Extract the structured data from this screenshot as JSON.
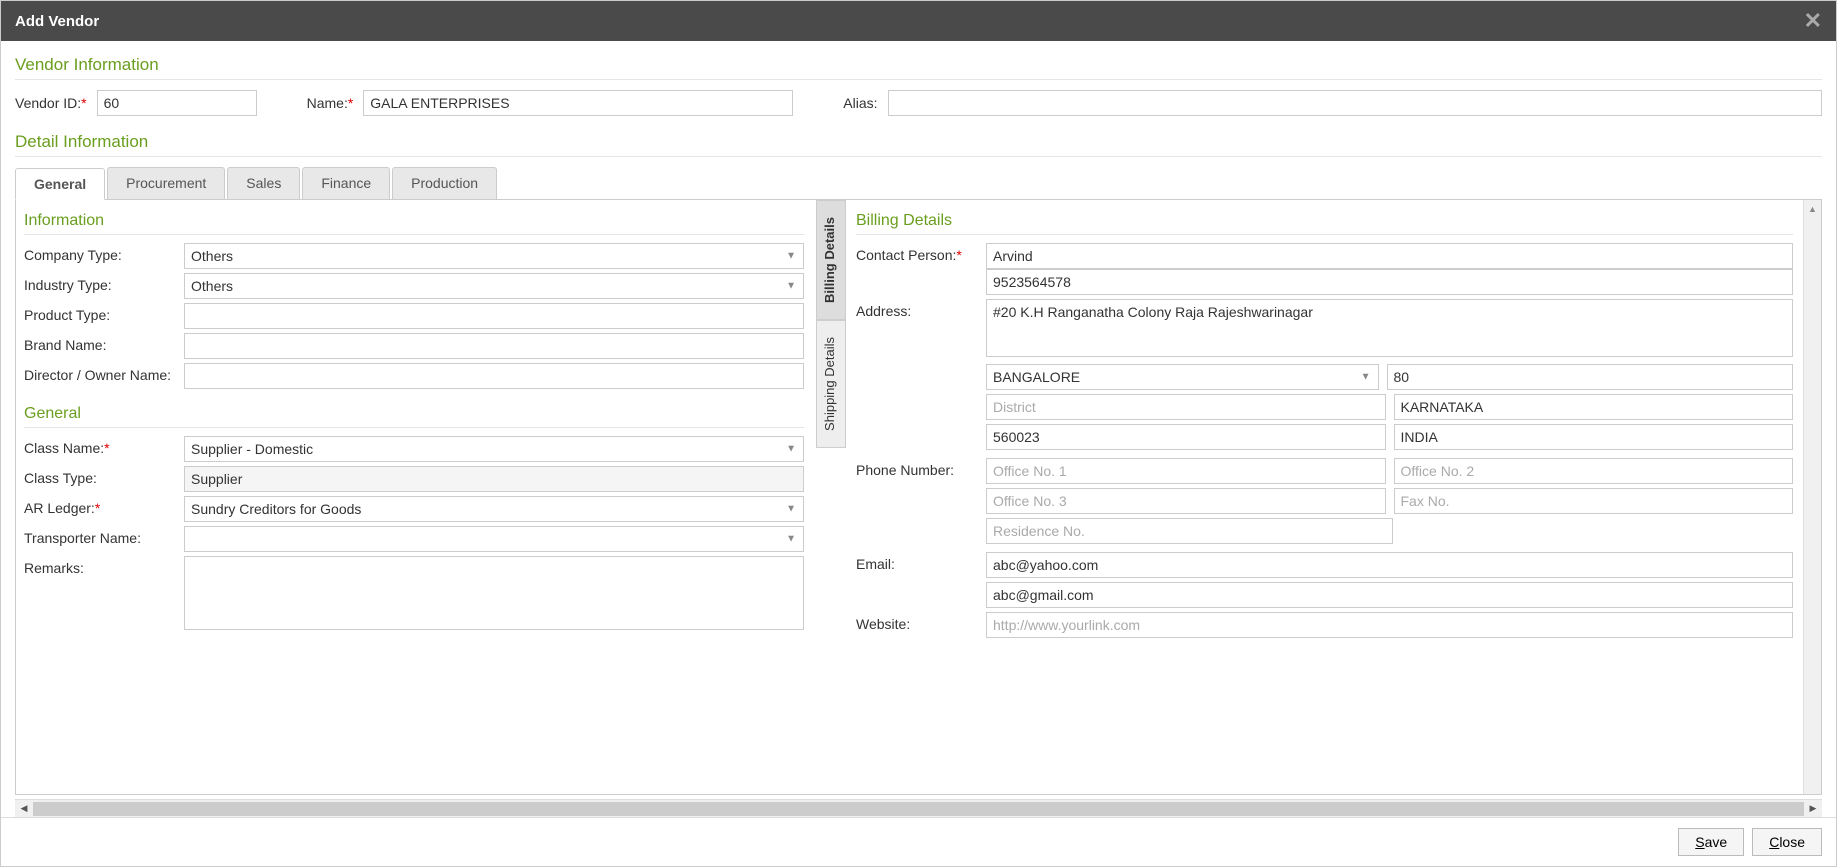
{
  "title": "Add Vendor",
  "sections": {
    "vendor_info": "Vendor Information",
    "detail_info": "Detail Information"
  },
  "vendor": {
    "id_label": "Vendor ID:",
    "id_value": "60",
    "name_label": "Name:",
    "name_value": "GALA ENTERPRISES",
    "alias_label": "Alias:",
    "alias_value": ""
  },
  "tabs": [
    "General",
    "Procurement",
    "Sales",
    "Finance",
    "Production"
  ],
  "info_panel": {
    "heading": "Information",
    "company_type_label": "Company Type:",
    "company_type_value": "Others",
    "industry_type_label": "Industry Type:",
    "industry_type_value": "Others",
    "product_type_label": "Product Type:",
    "product_type_value": "",
    "brand_name_label": "Brand Name:",
    "brand_name_value": "",
    "director_label": "Director / Owner Name:",
    "director_value": ""
  },
  "general_panel": {
    "heading": "General",
    "class_name_label": "Class Name:",
    "class_name_value": "Supplier - Domestic",
    "class_type_label": "Class Type:",
    "class_type_value": "Supplier",
    "ar_ledger_label": "AR Ledger:",
    "ar_ledger_value": "Sundry Creditors for Goods",
    "transporter_label": "Transporter Name:",
    "transporter_value": "",
    "remarks_label": "Remarks:",
    "remarks_value": ""
  },
  "side_tabs": {
    "billing": "Billing Details",
    "shipping": "Shipping Details"
  },
  "billing": {
    "heading": "Billing Details",
    "contact_label": "Contact Person:",
    "contact_value": "Arvind",
    "contact_phone": "9523564578",
    "address_label": "Address:",
    "address_value": "#20 K.H Ranganatha Colony Raja Rajeshwarinagar",
    "city_value": "BANGALORE",
    "zone_value": "80",
    "district_placeholder": "District",
    "state_value": "KARNATAKA",
    "pincode_value": "560023",
    "country_value": "INDIA",
    "phone_label": "Phone Number:",
    "office1_placeholder": "Office No. 1",
    "office2_placeholder": "Office No. 2",
    "office3_placeholder": "Office No. 3",
    "fax_placeholder": "Fax No.",
    "residence_placeholder": "Residence No.",
    "email_label": "Email:",
    "email1_value": "abc@yahoo.com",
    "email2_value": "abc@gmail.com",
    "website_label": "Website:",
    "website_placeholder": "http://www.yourlink.com"
  },
  "buttons": {
    "save": "Save",
    "close": "Close"
  }
}
